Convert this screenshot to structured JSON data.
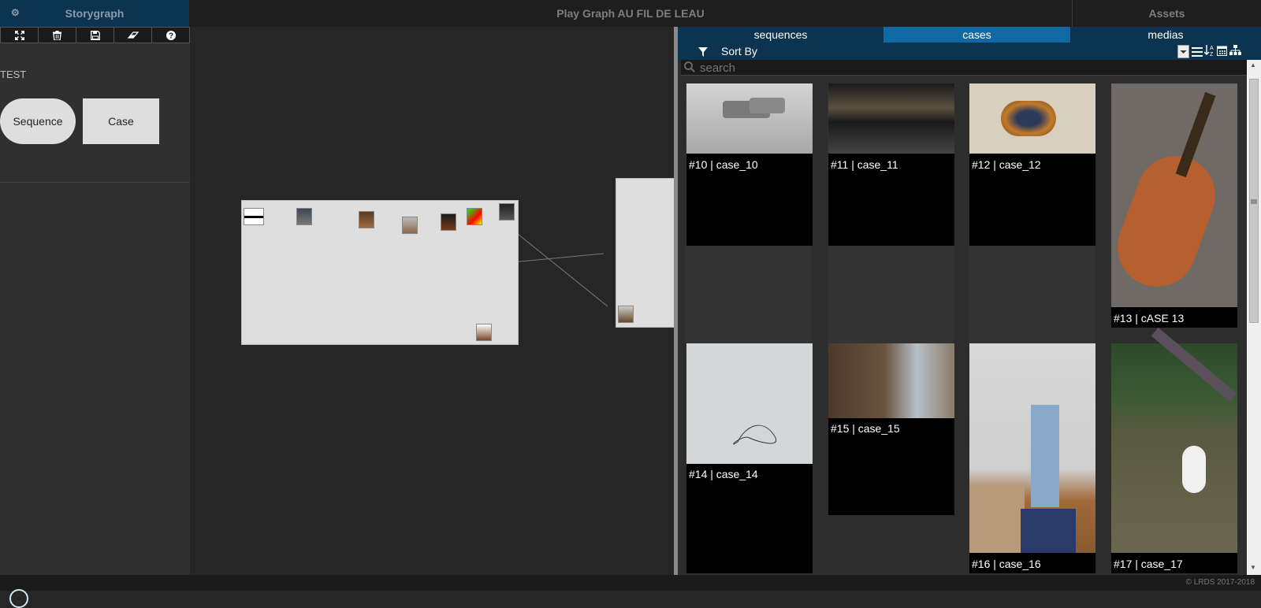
{
  "topbar": {
    "left_title": "Storygraph",
    "center_title": "Play Graph AU FIL DE LEAU",
    "right_title": "Assets"
  },
  "toolbar": {
    "icons": [
      "fullscreen-icon",
      "trash-icon",
      "save-icon",
      "eraser-icon",
      "help-icon"
    ]
  },
  "leftpanel": {
    "label": "TEST",
    "sequence_label": "Sequence",
    "case_label": "Case"
  },
  "assets": {
    "tabs": [
      "sequences",
      "cases",
      "medias"
    ],
    "active_tab": "cases",
    "sort_label": "Sort By",
    "search_placeholder": "search",
    "cards": [
      {
        "label": "#10 | case_10"
      },
      {
        "label": "#11 | case_11"
      },
      {
        "label": "#12 | case_12"
      },
      {
        "label": "#13 | cASE 13"
      },
      {
        "label": "#14 | case_14"
      },
      {
        "label": "#15 | case_15"
      },
      {
        "label": "#16 | case_16"
      },
      {
        "label": "#17 | case_17"
      }
    ]
  },
  "footer": {
    "copyright": "©  LRDS 2017-2018"
  },
  "colors": {
    "navy": "#0c3350",
    "active_tab": "#1169a3"
  }
}
